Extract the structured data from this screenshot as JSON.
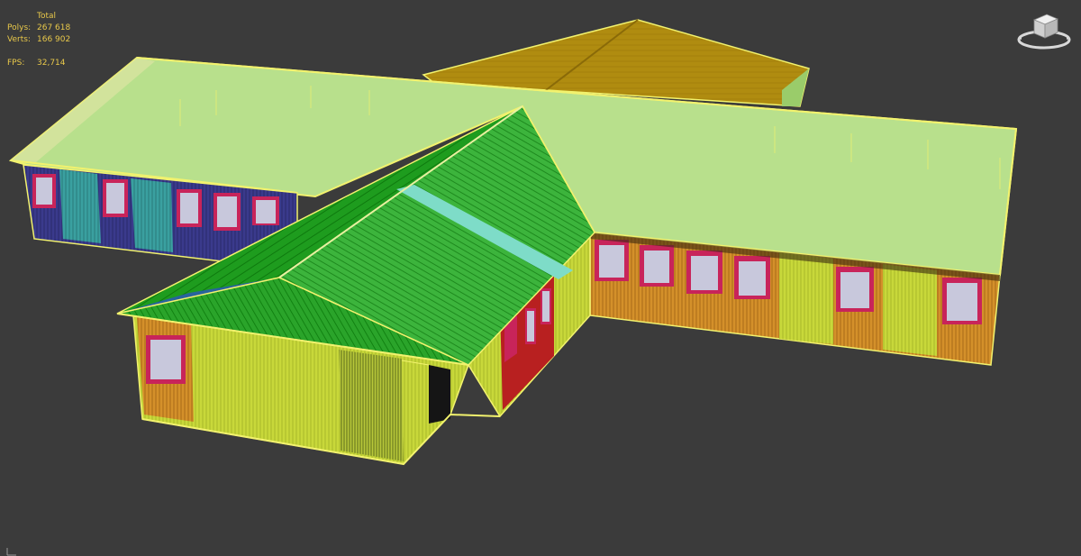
{
  "viewport": {
    "background": "#3b3b3b",
    "scene": "building-model"
  },
  "stats": {
    "header": "Total",
    "polys_label": "Polys:",
    "polys_value": "267 618",
    "verts_label": "Verts:",
    "verts_value": "166 902",
    "fps_label": "FPS:",
    "fps_value": "32,714",
    "color": "#e8c84a"
  },
  "viewcube": {
    "icon": "viewcube-icon"
  },
  "colors": {
    "selection_outline": "#f2f26e",
    "roof_main": "#b8e08c",
    "roof_back": "#b08c10",
    "roof_wing_left": "#1e9c1e",
    "roof_wing_right": "#3cb43c",
    "roof_skylight": "#7edcc8",
    "wall_orange": "#d4902a",
    "wall_lime": "#c8d83a",
    "wall_blue": "#3a3a8c",
    "wall_teal": "#3aa0a0",
    "window_frame": "#c8245a",
    "door_red": "#b82020"
  }
}
